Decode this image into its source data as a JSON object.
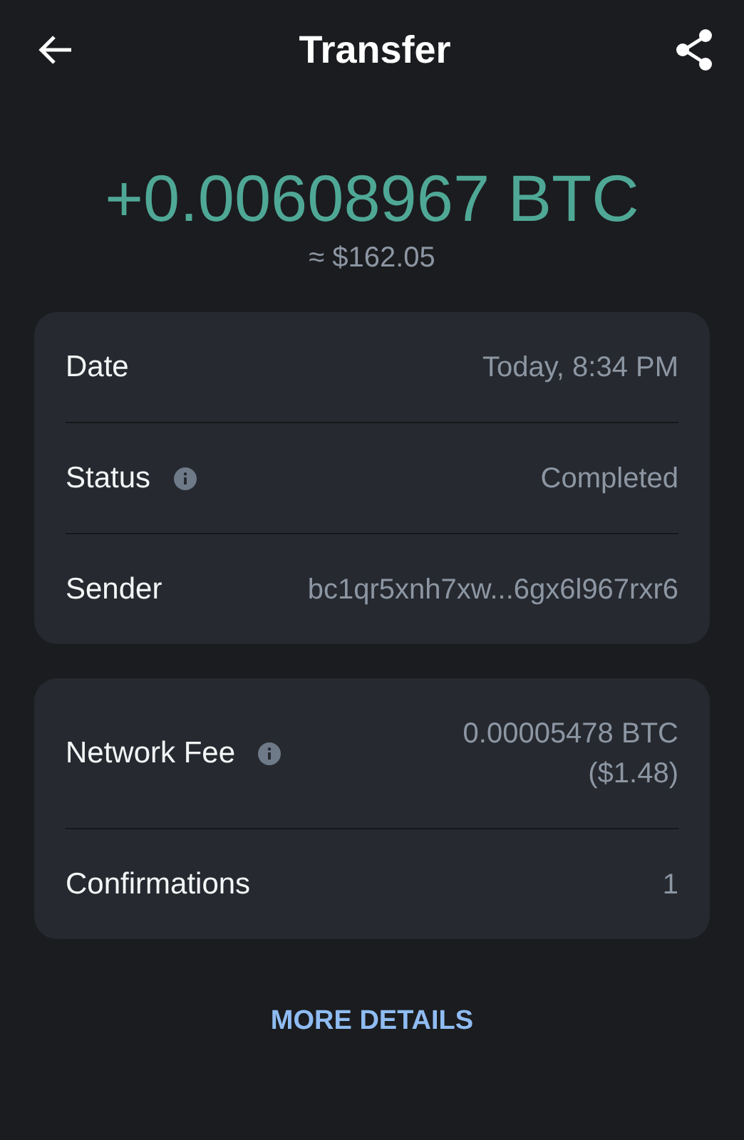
{
  "header": {
    "title": "Transfer"
  },
  "amount": {
    "value": "+0.00608967 BTC",
    "fiat": "≈ $162.05"
  },
  "cards": [
    {
      "rows": [
        {
          "label": "Date",
          "info": false,
          "value": [
            "Today, 8:34 PM"
          ]
        },
        {
          "label": "Status",
          "info": true,
          "value": [
            "Completed"
          ]
        },
        {
          "label": "Sender",
          "info": false,
          "value": [
            "bc1qr5xnh7xw...6gx6l967rxr6"
          ]
        }
      ]
    },
    {
      "rows": [
        {
          "label": "Network Fee",
          "info": true,
          "value": [
            "0.00005478 BTC",
            "($1.48)"
          ]
        },
        {
          "label": "Confirmations",
          "info": false,
          "value": [
            "1"
          ]
        }
      ]
    }
  ],
  "more_button": "MORE DETAILS"
}
